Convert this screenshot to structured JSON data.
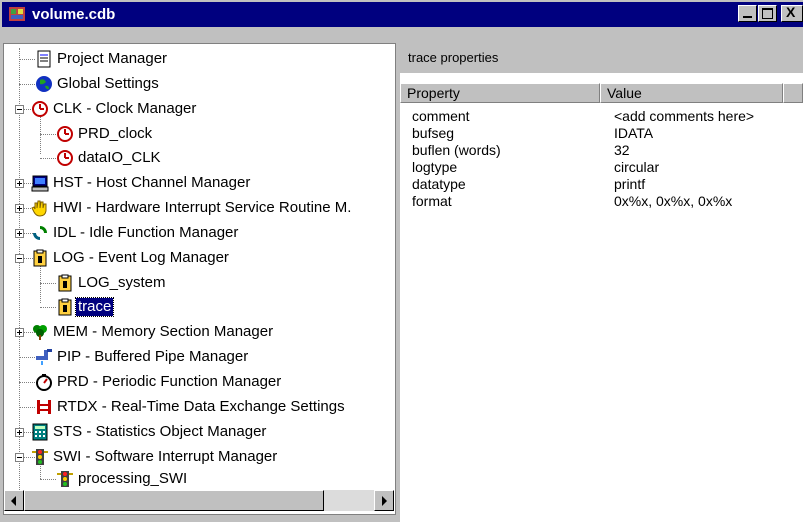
{
  "window": {
    "title": "volume.cdb",
    "buttons": {
      "minimize": "_",
      "maximize": "□",
      "close": "X"
    }
  },
  "tree": {
    "items": [
      {
        "label": "Project Manager",
        "icon": "document-icon"
      },
      {
        "label": "Global Settings",
        "icon": "globe-icon"
      },
      {
        "label": "CLK - Clock Manager",
        "icon": "clock-icon",
        "expanded": true
      },
      {
        "label": "PRD_clock",
        "icon": "clock-icon"
      },
      {
        "label": "dataIO_CLK",
        "icon": "clock-icon"
      },
      {
        "label": "HST - Host Channel Manager",
        "icon": "computer-icon",
        "collapsed": true
      },
      {
        "label": "HWI - Hardware Interrupt Service Routine M.",
        "icon": "hand-icon",
        "collapsed": true
      },
      {
        "label": "IDL - Idle Function Manager",
        "icon": "cycle-icon",
        "collapsed": true
      },
      {
        "label": "LOG - Event Log Manager",
        "icon": "log-icon",
        "expanded": true
      },
      {
        "label": "LOG_system",
        "icon": "log-icon"
      },
      {
        "label": "trace",
        "icon": "log-icon",
        "selected": true
      },
      {
        "label": "MEM - Memory Section Manager",
        "icon": "tree-icon",
        "collapsed": true
      },
      {
        "label": "PIP - Buffered Pipe Manager",
        "icon": "pipe-icon"
      },
      {
        "label": "PRD - Periodic Function Manager",
        "icon": "stopwatch-icon"
      },
      {
        "label": "RTDX - Real-Time Data Exchange Settings",
        "icon": "rtdx-icon"
      },
      {
        "label": "STS - Statistics Object Manager",
        "icon": "calculator-icon",
        "collapsed": true
      },
      {
        "label": "SWI - Software Interrupt Manager",
        "icon": "traffic-light-icon",
        "expanded": true
      },
      {
        "label": "processing_SWI",
        "icon": "traffic-light-icon"
      }
    ]
  },
  "properties": {
    "header": "trace properties",
    "columns": [
      "Property",
      "Value"
    ],
    "rows": [
      {
        "property": "comment",
        "value": "<add comments here>"
      },
      {
        "property": "bufseg",
        "value": "IDATA"
      },
      {
        "property": "buflen (words)",
        "value": "32"
      },
      {
        "property": "logtype",
        "value": "circular"
      },
      {
        "property": "datatype",
        "value": "printf"
      },
      {
        "property": "format",
        "value": "0x%x, 0x%x, 0x%x"
      }
    ]
  },
  "colors": {
    "titlebar": "#00007f",
    "selection": "#00007f",
    "chrome": "#c0c0c0"
  }
}
